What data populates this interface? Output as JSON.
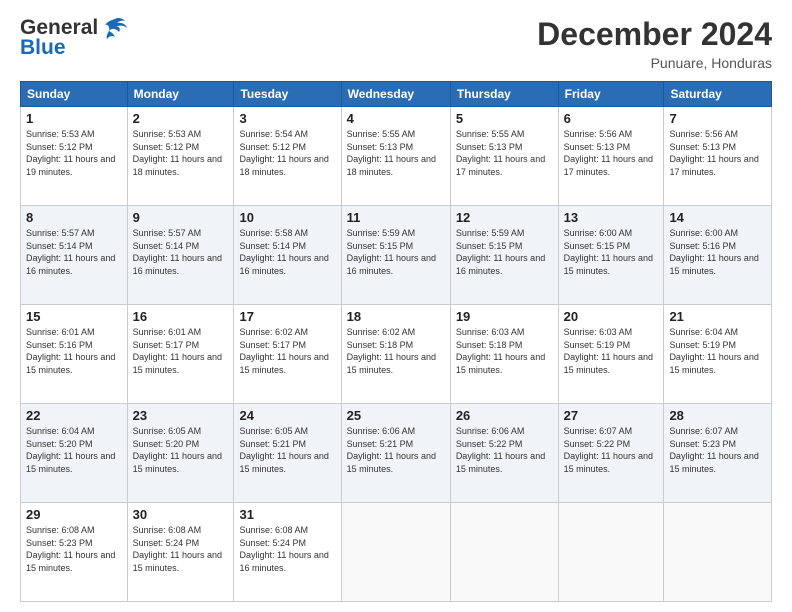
{
  "header": {
    "logo_line1": "General",
    "logo_line2": "Blue",
    "month": "December 2024",
    "location": "Punuare, Honduras"
  },
  "weekdays": [
    "Sunday",
    "Monday",
    "Tuesday",
    "Wednesday",
    "Thursday",
    "Friday",
    "Saturday"
  ],
  "weeks": [
    [
      {
        "day": "1",
        "sunrise": "5:53 AM",
        "sunset": "5:12 PM",
        "daylight": "11 hours and 19 minutes."
      },
      {
        "day": "2",
        "sunrise": "5:53 AM",
        "sunset": "5:12 PM",
        "daylight": "11 hours and 18 minutes."
      },
      {
        "day": "3",
        "sunrise": "5:54 AM",
        "sunset": "5:12 PM",
        "daylight": "11 hours and 18 minutes."
      },
      {
        "day": "4",
        "sunrise": "5:55 AM",
        "sunset": "5:13 PM",
        "daylight": "11 hours and 18 minutes."
      },
      {
        "day": "5",
        "sunrise": "5:55 AM",
        "sunset": "5:13 PM",
        "daylight": "11 hours and 17 minutes."
      },
      {
        "day": "6",
        "sunrise": "5:56 AM",
        "sunset": "5:13 PM",
        "daylight": "11 hours and 17 minutes."
      },
      {
        "day": "7",
        "sunrise": "5:56 AM",
        "sunset": "5:13 PM",
        "daylight": "11 hours and 17 minutes."
      }
    ],
    [
      {
        "day": "8",
        "sunrise": "5:57 AM",
        "sunset": "5:14 PM",
        "daylight": "11 hours and 16 minutes."
      },
      {
        "day": "9",
        "sunrise": "5:57 AM",
        "sunset": "5:14 PM",
        "daylight": "11 hours and 16 minutes."
      },
      {
        "day": "10",
        "sunrise": "5:58 AM",
        "sunset": "5:14 PM",
        "daylight": "11 hours and 16 minutes."
      },
      {
        "day": "11",
        "sunrise": "5:59 AM",
        "sunset": "5:15 PM",
        "daylight": "11 hours and 16 minutes."
      },
      {
        "day": "12",
        "sunrise": "5:59 AM",
        "sunset": "5:15 PM",
        "daylight": "11 hours and 16 minutes."
      },
      {
        "day": "13",
        "sunrise": "6:00 AM",
        "sunset": "5:15 PM",
        "daylight": "11 hours and 15 minutes."
      },
      {
        "day": "14",
        "sunrise": "6:00 AM",
        "sunset": "5:16 PM",
        "daylight": "11 hours and 15 minutes."
      }
    ],
    [
      {
        "day": "15",
        "sunrise": "6:01 AM",
        "sunset": "5:16 PM",
        "daylight": "11 hours and 15 minutes."
      },
      {
        "day": "16",
        "sunrise": "6:01 AM",
        "sunset": "5:17 PM",
        "daylight": "11 hours and 15 minutes."
      },
      {
        "day": "17",
        "sunrise": "6:02 AM",
        "sunset": "5:17 PM",
        "daylight": "11 hours and 15 minutes."
      },
      {
        "day": "18",
        "sunrise": "6:02 AM",
        "sunset": "5:18 PM",
        "daylight": "11 hours and 15 minutes."
      },
      {
        "day": "19",
        "sunrise": "6:03 AM",
        "sunset": "5:18 PM",
        "daylight": "11 hours and 15 minutes."
      },
      {
        "day": "20",
        "sunrise": "6:03 AM",
        "sunset": "5:19 PM",
        "daylight": "11 hours and 15 minutes."
      },
      {
        "day": "21",
        "sunrise": "6:04 AM",
        "sunset": "5:19 PM",
        "daylight": "11 hours and 15 minutes."
      }
    ],
    [
      {
        "day": "22",
        "sunrise": "6:04 AM",
        "sunset": "5:20 PM",
        "daylight": "11 hours and 15 minutes."
      },
      {
        "day": "23",
        "sunrise": "6:05 AM",
        "sunset": "5:20 PM",
        "daylight": "11 hours and 15 minutes."
      },
      {
        "day": "24",
        "sunrise": "6:05 AM",
        "sunset": "5:21 PM",
        "daylight": "11 hours and 15 minutes."
      },
      {
        "day": "25",
        "sunrise": "6:06 AM",
        "sunset": "5:21 PM",
        "daylight": "11 hours and 15 minutes."
      },
      {
        "day": "26",
        "sunrise": "6:06 AM",
        "sunset": "5:22 PM",
        "daylight": "11 hours and 15 minutes."
      },
      {
        "day": "27",
        "sunrise": "6:07 AM",
        "sunset": "5:22 PM",
        "daylight": "11 hours and 15 minutes."
      },
      {
        "day": "28",
        "sunrise": "6:07 AM",
        "sunset": "5:23 PM",
        "daylight": "11 hours and 15 minutes."
      }
    ],
    [
      {
        "day": "29",
        "sunrise": "6:08 AM",
        "sunset": "5:23 PM",
        "daylight": "11 hours and 15 minutes."
      },
      {
        "day": "30",
        "sunrise": "6:08 AM",
        "sunset": "5:24 PM",
        "daylight": "11 hours and 15 minutes."
      },
      {
        "day": "31",
        "sunrise": "6:08 AM",
        "sunset": "5:24 PM",
        "daylight": "11 hours and 16 minutes."
      },
      null,
      null,
      null,
      null
    ]
  ]
}
